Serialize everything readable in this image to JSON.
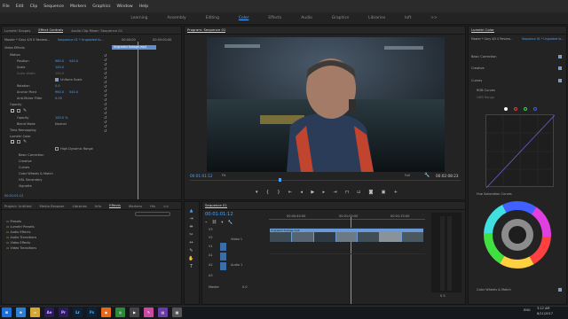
{
  "menu": [
    "File",
    "Edit",
    "Clip",
    "Sequence",
    "Markers",
    "Graphics",
    "Window",
    "Help"
  ],
  "workspaces": [
    "Learning",
    "Assembly",
    "Editing",
    "Color",
    "Effects",
    "Audio",
    "Graphics",
    "Libraries",
    "Ioft"
  ],
  "workspaces_more": ">>",
  "left_tabs": [
    "Lumetri Scopes",
    "Effect Controls",
    "Audio Clip Mixer: Sequence 01"
  ],
  "effect_controls": {
    "master": "Master * Gary 4/5 0 Review...",
    "sequence": "Sequence 01 * Ungraded fo...",
    "time_1": "00:00:00",
    "time_2": "00:05:00:00",
    "clip_bar": "Ungraded footage.mp4",
    "section_video": "Video Effects",
    "motion": "Motion",
    "position_label": "Position",
    "position_x": "960.0",
    "position_y": "540.0",
    "scale_label": "Scale",
    "scale_val": "100.0",
    "scale_width_label": "Scale Width",
    "scale_width_val": "100.0",
    "uniform_label": "Uniform Scale",
    "rotation_label": "Rotation",
    "rotation_val": "0.0",
    "anchor_label": "Anchor Point",
    "anchor_x": "960.0",
    "anchor_y": "540.0",
    "antiflicker_label": "Anti-flicker Filter",
    "antiflicker_val": "0.00",
    "opacity_section": "Opacity",
    "opacity_label": "Opacity",
    "opacity_val": "100.0 %",
    "blend_label": "Blend Mode",
    "blend_val": "Normal",
    "time_remap": "Time Remapping",
    "lumetri": "Lumetri Color",
    "hdr_label": "High Dynamic Range",
    "lumetri_items": [
      "Basic Correction",
      "Creative",
      "Curves",
      "Color Wheels & Match",
      "HSL Secondary",
      "Vignette"
    ],
    "timecode": "00:01:01:12"
  },
  "project": {
    "tabs": [
      "Project: Untitled",
      "Media Browser",
      "Libraries",
      "Info",
      "Effects",
      "Markers",
      "His"
    ],
    "tabs_more": ">>",
    "items": [
      "Presets",
      "Lumetri Presets",
      "Audio Effects",
      "Audio Transitions",
      "Video Effects",
      "Video Transitions"
    ]
  },
  "program": {
    "title": "Program: Sequence 01",
    "timecode": "00:01:01:12",
    "fit": "Fit",
    "full": "Full",
    "duration": "00:02:08:23"
  },
  "timeline": {
    "title": "Sequence 01",
    "timecode": "00:01:01:12",
    "ruler": [
      "00:00:45:00",
      "00:01:00:00",
      "00:01:15:00"
    ],
    "tracks": [
      "V3",
      "V2",
      "V1",
      "A1",
      "A2",
      "A3"
    ],
    "track_names": [
      "Video 1",
      "Audio 1"
    ],
    "clip_label": "Ungraded footage.mp4",
    "master_label": "Master",
    "master_val": "0.0",
    "meter_label": "S S"
  },
  "lumetri": {
    "title": "Lumetri Color",
    "master": "Master * Gary 4/5 0 Review...",
    "sequence": "Sequence 01 * Ungraded fo...",
    "basic": "Basic Correction",
    "creative": "Creative",
    "curves": "Curves",
    "rgb_curves": "RGB Curves",
    "hdr_range": "HDR Range",
    "hue_sat": "Hue Saturation Curves",
    "wheels": "Color Wheels & Match",
    "curve_colors": [
      "#ffffff",
      "#e03b3b",
      "#3bd04b",
      "#3b5fe0"
    ]
  },
  "taskbar": {
    "lang": "ENG",
    "time": "3:12 AM",
    "date": "8/11/2017",
    "apps": [
      "win",
      "ie",
      "folder",
      "ae",
      "pr",
      "lr",
      "ps",
      "firefox",
      "chrome",
      "media",
      "paint",
      "store",
      "app"
    ]
  },
  "colors": {
    "accent": "#4aa3ff",
    "panel": "#232323",
    "clip": "#6a9ad6",
    "taskbar": "#15181d"
  }
}
